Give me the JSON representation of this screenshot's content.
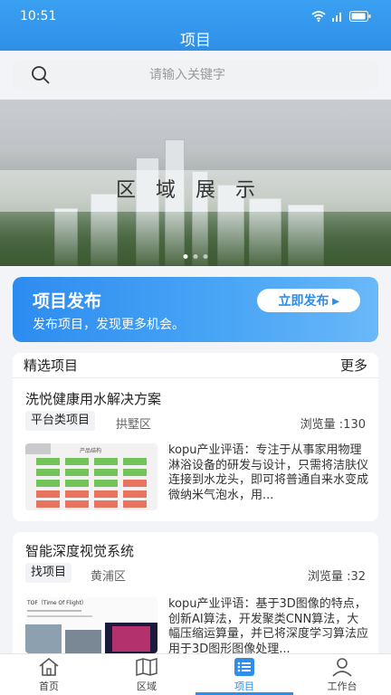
{
  "status": {
    "time": "10:51"
  },
  "header": {
    "title": "项目"
  },
  "search": {
    "placeholder": "请输入关键字"
  },
  "banner": {
    "text": "区域展示"
  },
  "publish": {
    "title": "项目发布",
    "subtitle": "发布项目，发现更多机会。",
    "button_label": "立即发布 ▸"
  },
  "featured": {
    "section_title": "精选项目",
    "more_label": "更多",
    "items": [
      {
        "title": "洗悦健康用水解决方案",
        "tag": "平台类项目",
        "district": "拱墅区",
        "views": "浏览量 :130",
        "description": "kopu产业评语：专注于从事家用物理淋浴设备的研发与设计，只需将洁肤仪连接到水龙头，即可将普通自来水变成微纳米气泡水，用..."
      },
      {
        "title": "智能深度视觉系统",
        "tag": "找项目",
        "district": "黄浦区",
        "views": "浏览量 :32",
        "description": "kopu产业评语：基于3D图像的特点，创新AI算法，开发聚类CNN算法，大幅压缩运算量，并已将深度学习算法应用于3D图形图像处理..."
      }
    ]
  },
  "thumb1": {
    "label": "产品结构"
  },
  "thumb2": {
    "label": "TOF（Time Of Flight）"
  },
  "tabs": [
    {
      "label": "首页",
      "icon": "home-icon"
    },
    {
      "label": "区域",
      "icon": "map-icon"
    },
    {
      "label": "项目",
      "icon": "list-icon"
    },
    {
      "label": "工作台",
      "icon": "user-icon"
    }
  ],
  "colors": {
    "primary": "#2f8fe8",
    "banner_gradient_end": "#6ab8f8"
  }
}
